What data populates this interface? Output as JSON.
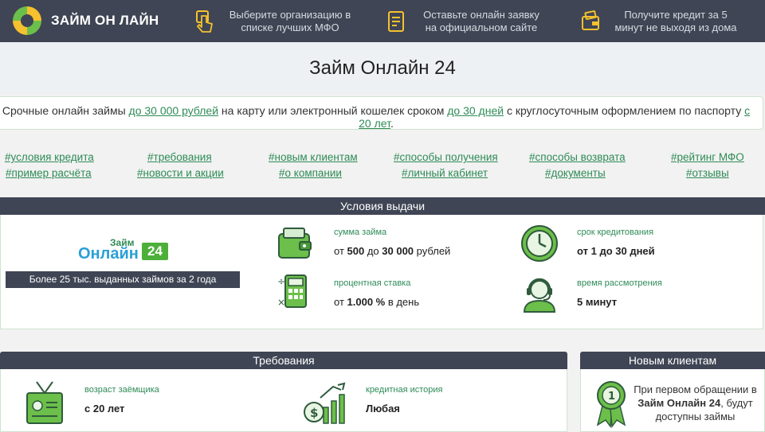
{
  "header": {
    "logo_text": "ЗАЙМ ОН ЛАЙН",
    "steps": [
      {
        "icon": "hand-pointer-icon",
        "text": "Выберите организацию в списке лучших МФО"
      },
      {
        "icon": "form-document-icon",
        "text": "Оставьте онлайн заявку на официальном сайте"
      },
      {
        "icon": "wallet-card-icon",
        "text": "Получите кредит за 5 минут не выходя из дома"
      }
    ]
  },
  "title": "Займ Онлайн 24",
  "intro": {
    "part1": "Срочные онлайн займы ",
    "link1": "до 30 000 рублей",
    "part2": " на карту или электронный кошелек сроком ",
    "link2": "до 30 дней",
    "part3": " с круглосуточным оформлением по паспорту ",
    "link3": "с 20 лет",
    "part4": "."
  },
  "tags_row1": [
    "#условия кредита",
    "#требования",
    "#новым клиентам",
    "#способы получения",
    "#способы возврата",
    "#рейтинг МФО"
  ],
  "tags_row2": [
    "#пример расчёта",
    "#новости и акции",
    "#о компании",
    "#личный кабинет",
    "#документы",
    "#отзывы"
  ],
  "conditions": {
    "header": "Условия выдачи",
    "brand_line1": "Займ",
    "brand_line2": "Онлайн",
    "brand_num": "24",
    "brand_caption": "Более 25 тыс. выданных займов за 2 года",
    "items": [
      {
        "icon": "wallet-icon",
        "label": "сумма займа",
        "pre": "от ",
        "b1": "500",
        "mid": " до ",
        "b2": "30 000",
        "post": " рублей"
      },
      {
        "icon": "clock-icon",
        "label": "срок кредитования",
        "pre": "",
        "b1": "от 1 до 30 дней",
        "mid": "",
        "b2": "",
        "post": ""
      },
      {
        "icon": "calculator-icon",
        "label": "процентная ставка",
        "pre": "от ",
        "b1": "1.000 %",
        "mid": "",
        "b2": "",
        "post": " в день"
      },
      {
        "icon": "operator-headset-icon",
        "label": "время рассмотрения",
        "pre": "",
        "b1": "5 минут",
        "mid": "",
        "b2": "",
        "post": ""
      }
    ]
  },
  "requirements": {
    "header": "Требования",
    "items": [
      {
        "icon": "id-badge-icon",
        "label": "возраст заёмщика",
        "value": "с 20 лет"
      },
      {
        "icon": "money-growth-icon",
        "label": "кредитная история",
        "value": "Любая"
      }
    ]
  },
  "new_clients": {
    "header": "Новым клиентам",
    "text_pre": "При первом обращении в ",
    "text_bold": "Займ Онлайн 24",
    "text_post": ", будут доступны займы"
  },
  "colors": {
    "dark": "#3f4554",
    "green": "#2e8b57",
    "accent_green": "#5aa55a"
  }
}
